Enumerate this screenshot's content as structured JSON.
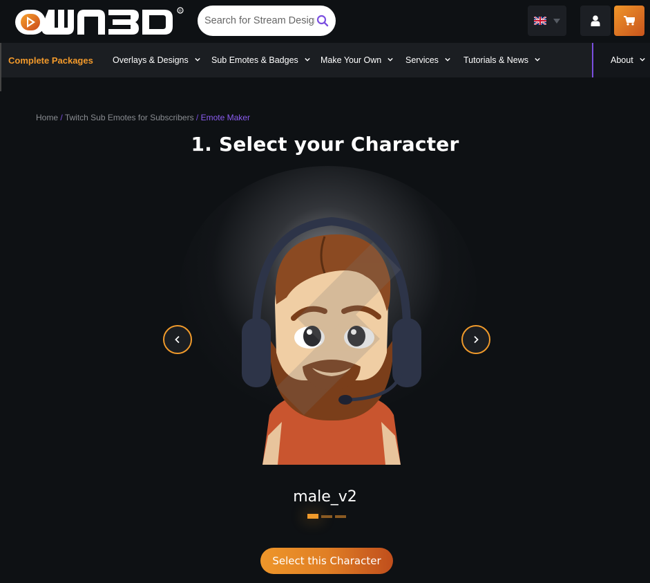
{
  "header": {
    "logo_text": "OWN3D",
    "search": {
      "placeholder": "Search for Stream Designs",
      "value": ""
    },
    "language": {
      "selected": "English (UK)",
      "icon": "uk-flag-icon"
    },
    "user_icon": "user-icon",
    "cart_icon": "cart-icon"
  },
  "nav": {
    "items": [
      {
        "label": "Complete Packages",
        "highlight": true,
        "dropdown": false
      },
      {
        "label": "Overlays & Designs",
        "dropdown": true
      },
      {
        "label": "Sub Emotes & Badges",
        "dropdown": true
      },
      {
        "label": "Make Your Own",
        "dropdown": true
      },
      {
        "label": "Services",
        "dropdown": true
      },
      {
        "label": "Tutorials & News",
        "dropdown": true
      },
      {
        "label": "About",
        "dropdown": true
      }
    ]
  },
  "breadcrumb": {
    "items": [
      "Home",
      "Twitch Sub Emotes for Subscribers",
      "Emote Maker"
    ],
    "separator": "/"
  },
  "main": {
    "title": "1. Select your Character",
    "character_name": "male_v2",
    "carousel": {
      "current": 1,
      "total": 3
    },
    "select_button": "Select this Character"
  },
  "colors": {
    "accent_orange": "#f09a2b",
    "accent_purple": "#7b4fe0",
    "background": "#0e1114",
    "nav_background": "#1b1e22"
  }
}
